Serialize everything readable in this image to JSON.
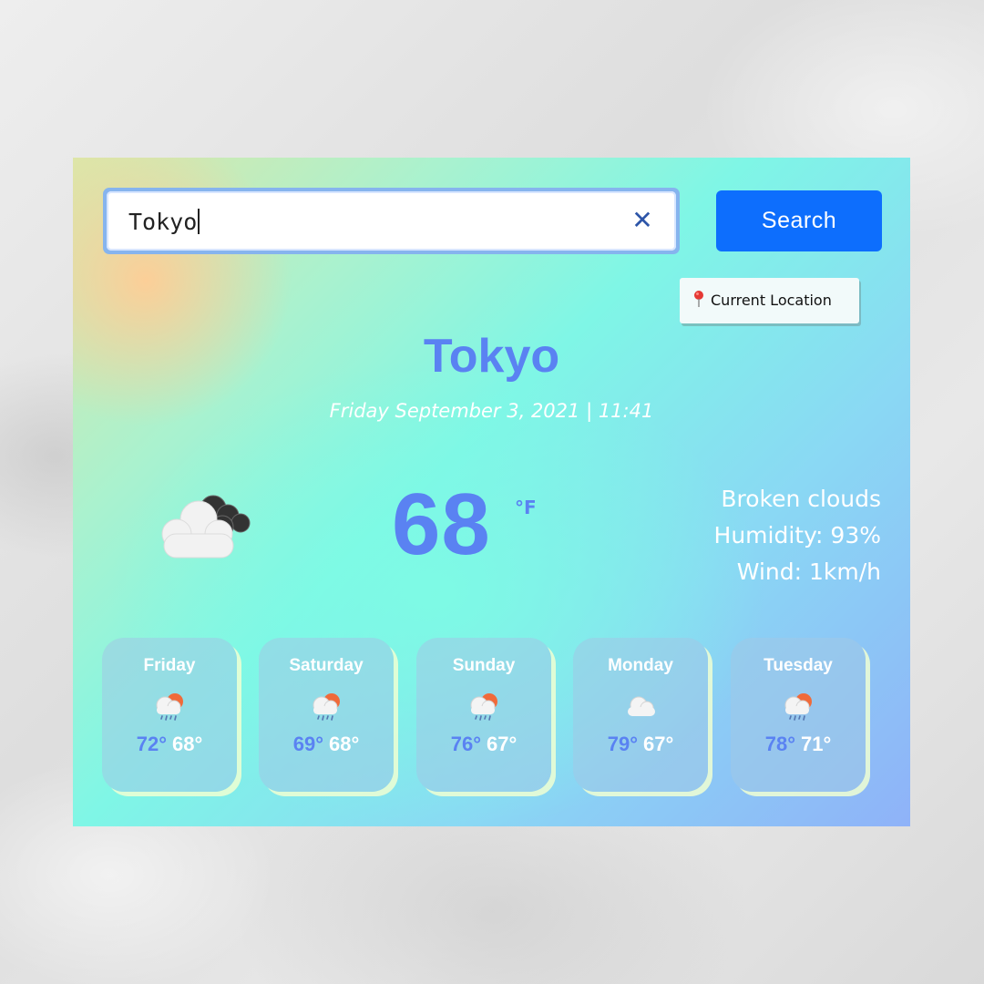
{
  "search": {
    "value": "Tokyo",
    "clear_icon": "close-icon",
    "button_label": "Search"
  },
  "location_button": {
    "icon": "pin-icon",
    "label": "Current Location"
  },
  "current": {
    "city": "Tokyo",
    "datetime": "Friday September 3, 2021 | 11:41",
    "icon": "broken-clouds-icon",
    "temperature": "68",
    "unit": "°F",
    "description": "Broken clouds",
    "humidity": "Humidity: 93%",
    "wind": "Wind: 1km/h"
  },
  "forecast": [
    {
      "day": "Friday",
      "icon": "rain-sun-icon",
      "high": "72°",
      "low": "68°"
    },
    {
      "day": "Saturday",
      "icon": "rain-sun-icon",
      "high": "69°",
      "low": "68°"
    },
    {
      "day": "Sunday",
      "icon": "rain-sun-icon",
      "high": "76°",
      "low": "67°"
    },
    {
      "day": "Monday",
      "icon": "cloud-icon",
      "high": "79°",
      "low": "67°"
    },
    {
      "day": "Tuesday",
      "icon": "rain-sun-icon",
      "high": "78°",
      "low": "71°"
    }
  ],
  "colors": {
    "accent": "#5a82f2",
    "button": "#0d6efd",
    "text_light": "#ffffff"
  }
}
